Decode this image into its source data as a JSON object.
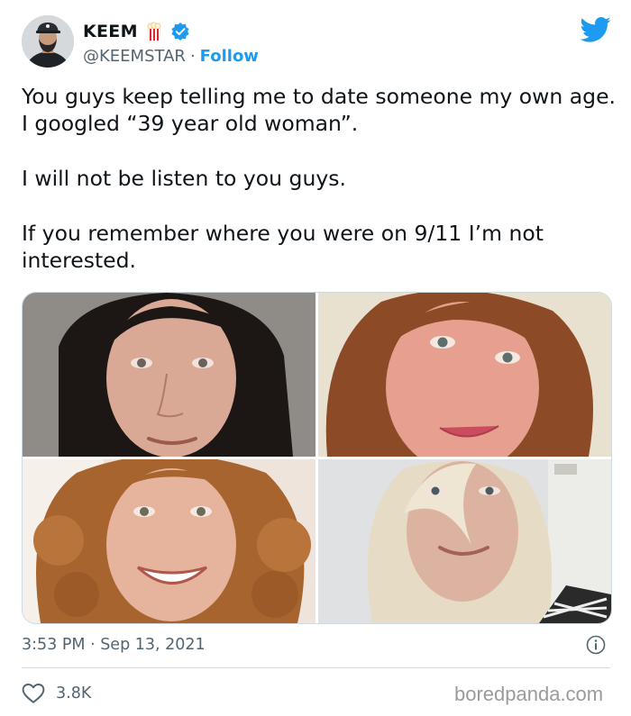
{
  "author": {
    "display_name": "KEEM",
    "handle": "@KEEMSTAR",
    "separator": "·",
    "follow_label": "Follow",
    "name_emoji": "popcorn-icon",
    "verified_icon": "verified-badge-icon",
    "avatar": "avatar"
  },
  "platform_icon": "twitter-bird-icon",
  "tweet": {
    "paragraphs": [
      "You guys keep telling me to date someone my own age. I googled “39 year old woman”.",
      "I will not be listen to you guys.",
      "If you remember where you were on 9/11 I’m not interested."
    ]
  },
  "media": {
    "photo_count": 4
  },
  "meta": {
    "timestamp": "3:53 PM · Sep 13, 2021",
    "info_icon": "info-icon"
  },
  "engagement": {
    "like_icon": "heart-icon",
    "like_count": "3.8K"
  },
  "watermark": "boredpanda.com",
  "colors": {
    "accent": "#1d9bf0",
    "text": "#0f1419",
    "muted": "#536471",
    "border": "#cfd9de"
  }
}
